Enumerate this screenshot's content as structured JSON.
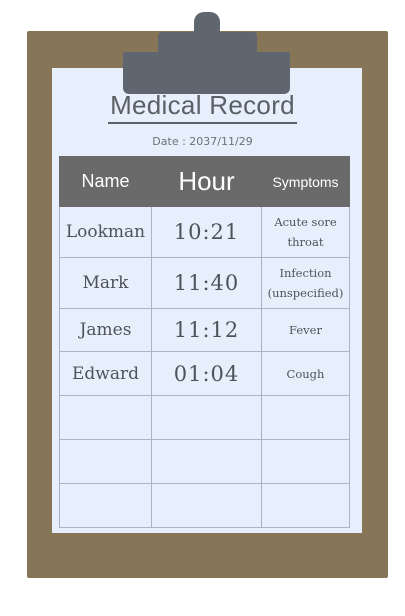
{
  "record": {
    "title": "Medical Record",
    "date": "Date  :  2037/11/29",
    "columns": [
      "Name",
      "Hour",
      "Symptoms"
    ],
    "rows": [
      {
        "name": "Lookman",
        "hour": "10:21",
        "symptom_line1": "Acute sore",
        "symptom_line2": "throat"
      },
      {
        "name": "Mark",
        "hour": "11:40",
        "symptom_line1": "Infection",
        "symptom_line2": "(unspecified)"
      },
      {
        "name": "James",
        "hour": "11:12",
        "symptom_line1": "Fever",
        "symptom_line2": ""
      },
      {
        "name": "Edward",
        "hour": "01:04",
        "symptom_line1": "Cough",
        "symptom_line2": ""
      }
    ],
    "empty_rows": 3
  },
  "colors": {
    "board": "#867556",
    "clip": "#5f6670",
    "paper": "#e6effb",
    "header": "#6a6a6a"
  }
}
